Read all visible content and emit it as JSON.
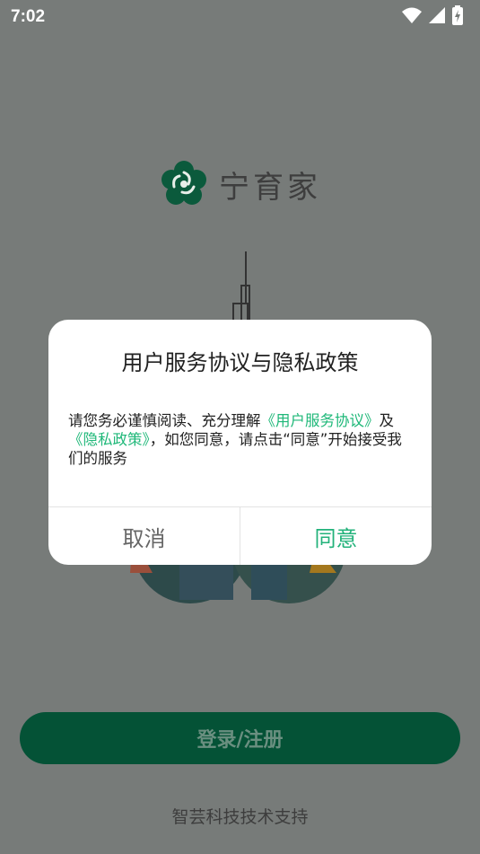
{
  "status_bar": {
    "time": "7:02",
    "icons": [
      "wifi-icon",
      "signal-icon",
      "battery-charging-icon"
    ]
  },
  "app": {
    "name": "宁育家",
    "logo_icon": "plum-blossom-logo"
  },
  "main": {
    "login_button": "登录/注册",
    "support_text": "智芸科技技术支持"
  },
  "dialog": {
    "title": "用户服务协议与隐私政策",
    "body_prefix": "请您务必谨慎阅读、充分理解",
    "link_agreement": "《用户服务协议》",
    "body_and": "及",
    "link_privacy": "《隐私政策》",
    "body_suffix": "，如您同意，请点击“同意”开始接受我们的服务",
    "cancel_label": "取消",
    "agree_label": "同意"
  },
  "colors": {
    "overlay": "#777b79",
    "brand_green": "#045236",
    "link_green": "#1fb879"
  }
}
